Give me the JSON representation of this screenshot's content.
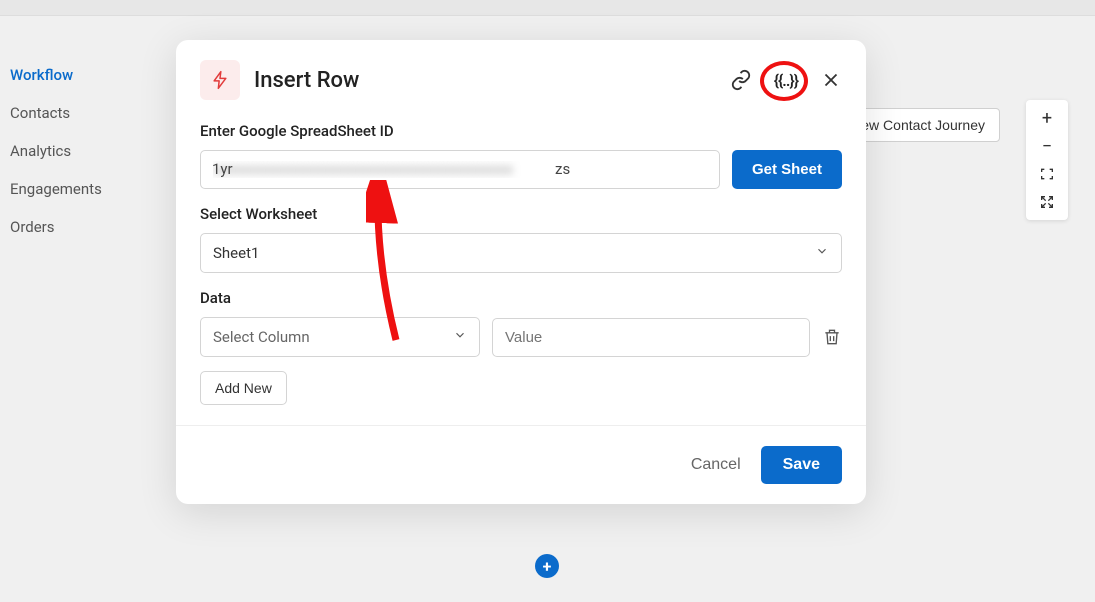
{
  "sidebar": {
    "items": [
      {
        "label": "Workflow",
        "active": true
      },
      {
        "label": "Contacts",
        "active": false
      },
      {
        "label": "Analytics",
        "active": false
      },
      {
        "label": "Engagements",
        "active": false
      },
      {
        "label": "Orders",
        "active": false
      }
    ]
  },
  "background": {
    "view_journey_label": "View Contact Journey"
  },
  "modal": {
    "title": "Insert Row",
    "params_symbol": "{{..}}",
    "sheet_id_label": "Enter Google SpreadSheet ID",
    "sheet_id_prefix": "1yr",
    "sheet_id_suffix": "zs",
    "get_sheet_label": "Get Sheet",
    "select_worksheet_label": "Select Worksheet",
    "worksheet_value": "Sheet1",
    "data_label": "Data",
    "column_placeholder": "Select Column",
    "value_placeholder": "Value",
    "add_new_label": "Add New",
    "cancel_label": "Cancel",
    "save_label": "Save"
  },
  "zoom": {
    "plus_label": "+",
    "minus_label": "−"
  }
}
